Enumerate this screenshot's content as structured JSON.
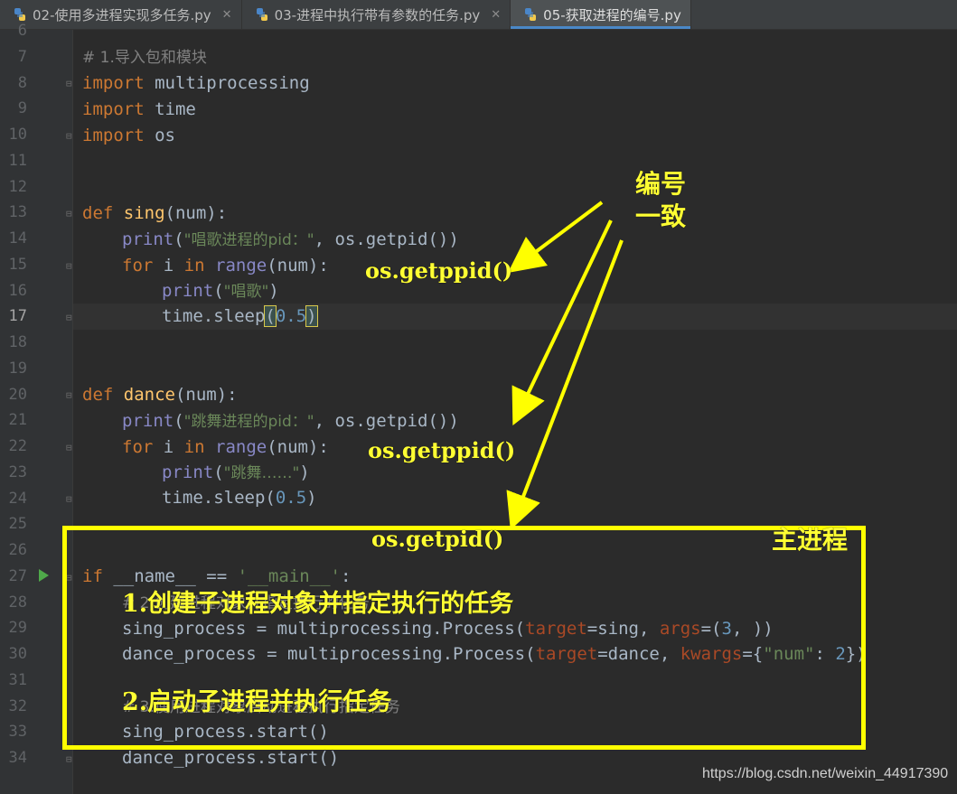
{
  "tabs": [
    {
      "label": "02-使用多进程实现多任务.py",
      "active": false
    },
    {
      "label": "03-进程中执行带有参数的任务.py",
      "active": false
    },
    {
      "label": "05-获取进程的编号.py",
      "active": true
    }
  ],
  "line_numbers": [
    "6",
    "7",
    "8",
    "9",
    "10",
    "11",
    "12",
    "13",
    "14",
    "15",
    "16",
    "17",
    "18",
    "19",
    "20",
    "21",
    "22",
    "23",
    "24",
    "25",
    "26",
    "27",
    "28",
    "29",
    "30",
    "31",
    "32",
    "33",
    "34"
  ],
  "current_line": "17",
  "code": {
    "l7": "# 1.导入包和模块",
    "l8_kw": "import",
    "l8_mod": " multiprocessing",
    "l9_kw": "import",
    "l9_mod": " time",
    "l10_kw": "import",
    "l10_mod": " os",
    "l13_kw": "def",
    "l13_fn": "sing",
    "l13_rest": "(num):",
    "l14_print": "print",
    "l14_paren": "(",
    "l14_str": "\"唱歌进程的pid：\"",
    "l14_rest": ", os.getpid())",
    "l15_for": "for",
    "l15_i": " i ",
    "l15_in": "in",
    "l15_range": "range",
    "l15_rest": "(num):",
    "l16_print": "print",
    "l16_paren": "(",
    "l16_str": "\"唱歌\"",
    "l16_close": ")",
    "l17_a": "time.sleep",
    "l17_open": "(",
    "l17_num": "0.5",
    "l17_close": ")",
    "l20_kw": "def",
    "l20_fn": "dance",
    "l20_rest": "(num):",
    "l21_print": "print",
    "l21_paren": "(",
    "l21_str": "\"跳舞进程的pid：\"",
    "l21_rest": ", os.getpid())",
    "l22_for": "for",
    "l22_i": " i ",
    "l22_in": "in",
    "l22_range": "range",
    "l22_rest": "(num):",
    "l23_print": "print",
    "l23_paren": "(",
    "l23_str": "\"跳舞……\"",
    "l23_close": ")",
    "l24_a": "time.sleep(",
    "l24_num": "0.5",
    "l24_close": ")",
    "l27_if": "if",
    "l27_mid": " __name__ == ",
    "l27_str": "'__main__'",
    "l27_colon": ":",
    "l28": "# 2.创建进程对象并指定执行的任务",
    "l29_a": "sing_process = multiprocessing.Process(",
    "l29_p1": "target",
    "l29_b": "=sing, ",
    "l29_p2": "args",
    "l29_c": "=(",
    "l29_num": "3",
    "l29_d": ", ))",
    "l30_a": "dance_process = multiprocessing.Process(",
    "l30_p1": "target",
    "l30_b": "=dance, ",
    "l30_p2": "kwargs",
    "l30_c": "={",
    "l30_str": "\"num\"",
    "l30_d": ": ",
    "l30_num": "2",
    "l30_e": "})",
    "l32": "# 3.使用进程对象启动进程执行指定任务",
    "l33": "sing_process.start()",
    "l34": "dance_process.start()"
  },
  "annotations": {
    "same_id_line1": "编号",
    "same_id_line2": "一致",
    "getppid_1": "os.getppid()",
    "getppid_2": "os.getppid()",
    "getpid": "os.getpid()",
    "main_process": "主进程",
    "step1": "1.创建子进程对象并指定执行的任务",
    "step2": "2.启动子进程并执行任务"
  },
  "watermark": "https://blog.csdn.net/weixin_44917390",
  "colors": {
    "annotation": "#ffff33",
    "keyword": "#cc7832",
    "function": "#ffc66d",
    "builtin": "#8888c6",
    "string": "#6a8759",
    "number": "#6897bb",
    "comment": "#808080"
  }
}
